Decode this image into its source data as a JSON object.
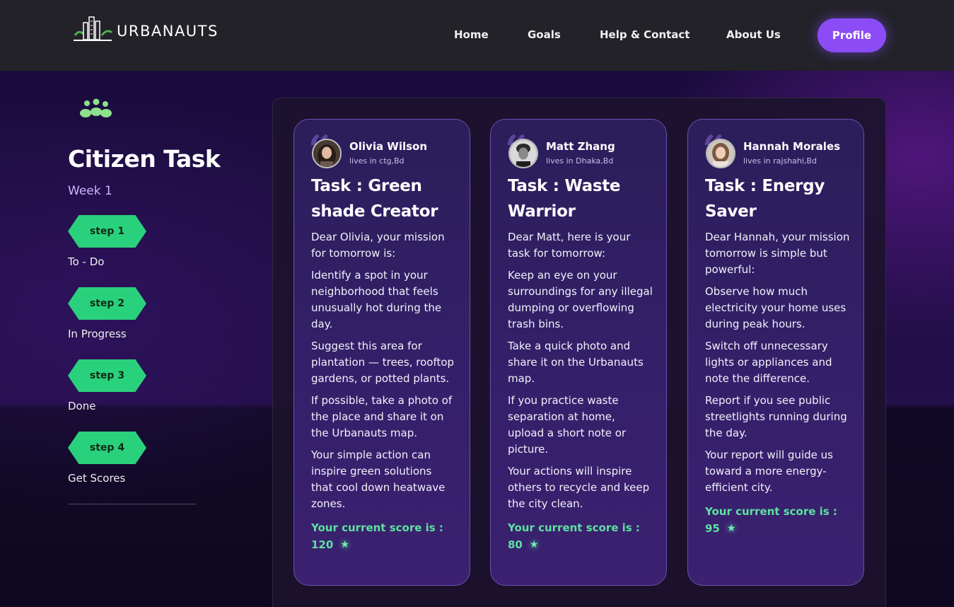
{
  "brand": {
    "name": "URBANAUTS"
  },
  "nav": {
    "items": [
      {
        "label": "Home"
      },
      {
        "label": "Goals"
      },
      {
        "label": "Help & Contact"
      },
      {
        "label": "About Us"
      }
    ],
    "profile_label": "Profile"
  },
  "sidebar": {
    "title": "Citizen Task",
    "week": "Week 1",
    "steps": [
      {
        "badge": "step 1",
        "label": "To - Do"
      },
      {
        "badge": "step 2",
        "label": "In Progress"
      },
      {
        "badge": "step 3",
        "label": "Done"
      },
      {
        "badge": "step 4",
        "label": "Get Scores"
      }
    ]
  },
  "cards": [
    {
      "name": "Olivia Wilson",
      "location": "lives in ctg,Bd",
      "title": "Task : Green shade Creator",
      "paragraphs": [
        "Dear Olivia, your mission for tomorrow is:",
        "Identify a spot in your neighborhood that feels unusually hot during the day.",
        "Suggest this area for plantation — trees, rooftop gardens, or potted plants.",
        "If possible, take a photo of the place and share it on the Urbanauts map.",
        "Your simple action can inspire green solutions that cool down heatwave zones."
      ],
      "score_label": "Your current score is :",
      "score": "120"
    },
    {
      "name": "Matt Zhang",
      "location": "lives in Dhaka,Bd",
      "title": "Task : Waste Warrior",
      "paragraphs": [
        "Dear Matt, here is your task for tomorrow:",
        "Keep an eye on your surroundings for any illegal dumping or overflowing trash bins.",
        "Take a quick photo and share it on the Urbanauts map.",
        "If you practice waste separation at home, upload a short note or picture.",
        "Your actions will inspire others to recycle and keep the city clean."
      ],
      "score_label": "Your current score is :",
      "score": "80"
    },
    {
      "name": "Hannah Morales",
      "location": "lives in rajshahi,Bd",
      "title": "Task : Energy Saver",
      "paragraphs": [
        "Dear Hannah, your mission tomorrow is simple but powerful:",
        "Observe how much electricity your home uses during peak hours.",
        "Switch off unnecessary lights or appliances and note the difference.",
        "Report if you see public streetlights running during the day.",
        "Your report will guide us toward a more energy-efficient city."
      ],
      "score_label": "Your current score is :",
      "score": "95"
    }
  ],
  "colors": {
    "accent_purple": "#8b4cf5",
    "step_green": "#2ad17c",
    "score_green": "#5de0a0"
  },
  "icons": {
    "logo": "building-leaf-logo-icon",
    "sidebar": "people-group-icon",
    "score": "star-icon",
    "quote": "quote-icon"
  }
}
